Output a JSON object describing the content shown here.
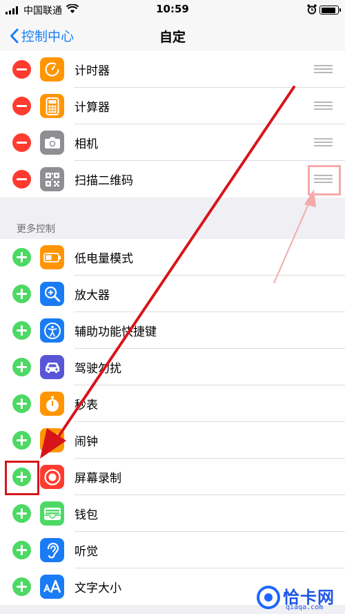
{
  "status_bar": {
    "carrier": "中国联通",
    "time": "10:59"
  },
  "nav": {
    "back_label": "控制中心",
    "title": "自定"
  },
  "included": [
    {
      "label": "计时器",
      "icon": "timer-icon",
      "color": "#ff9500"
    },
    {
      "label": "计算器",
      "icon": "calculator-icon",
      "color": "#ff9500"
    },
    {
      "label": "相机",
      "icon": "camera-icon",
      "color": "#8e8e93"
    },
    {
      "label": "扫描二维码",
      "icon": "qr-code-icon",
      "color": "#8e8e93"
    }
  ],
  "more_header": "更多控制",
  "more": [
    {
      "label": "低电量模式",
      "icon": "battery-icon",
      "color": "#ff9500"
    },
    {
      "label": "放大器",
      "icon": "magnifier-icon",
      "color": "#1a7cf5"
    },
    {
      "label": "辅助功能快捷键",
      "icon": "accessibility-icon",
      "color": "#1a7cf5"
    },
    {
      "label": "驾驶勿扰",
      "icon": "car-icon",
      "color": "#5856d6"
    },
    {
      "label": "秒表",
      "icon": "stopwatch-icon",
      "color": "#ff9500"
    },
    {
      "label": "闹钟",
      "icon": "alarm-icon",
      "color": "#ff9500"
    },
    {
      "label": "屏幕录制",
      "icon": "screen-record-icon",
      "color": "#ff3b30"
    },
    {
      "label": "钱包",
      "icon": "wallet-icon",
      "color": "#4cd964"
    },
    {
      "label": "听觉",
      "icon": "ear-icon",
      "color": "#1a7cf5"
    },
    {
      "label": "文字大小",
      "icon": "text-size-icon",
      "color": "#1a7cf5"
    }
  ],
  "watermark": {
    "name": "恰卡网",
    "domain": "qiaqa.com"
  }
}
